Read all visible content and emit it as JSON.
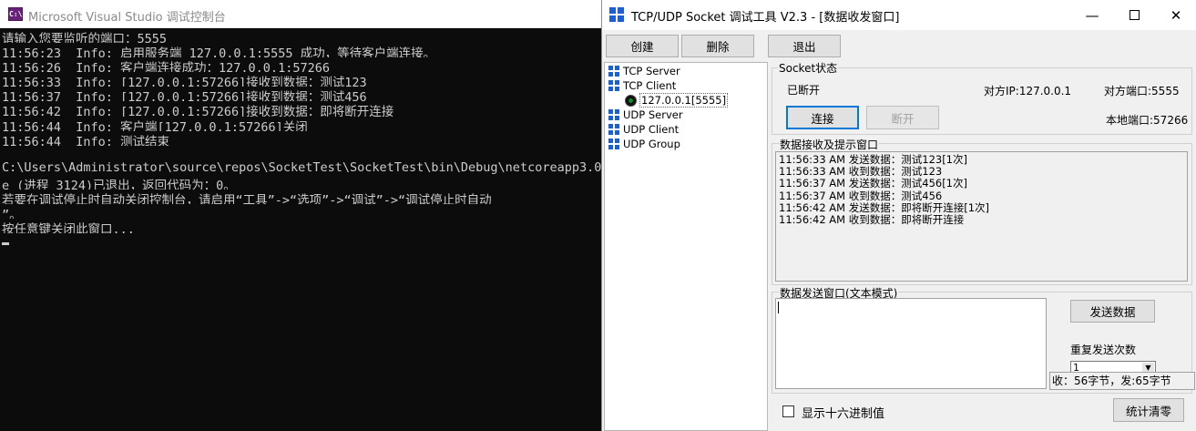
{
  "console": {
    "title": "Microsoft Visual Studio 调试控制台",
    "icon": "visual-studio-icon",
    "icon_text": "C:\\",
    "lines": [
      "请输入您要监听的端口：5555",
      "11:56:23  Info: 启用服务端 127.0.0.1:5555 成功，等待客户端连接。",
      "11:56:26  Info: 客户端连接成功：127.0.0.1:57266",
      "11:56:33  Info: [127.0.0.1:57266]接收到数据：测试123",
      "11:56:37  Info: [127.0.0.1:57266]接收到数据：测试456",
      "11:56:42  Info: [127.0.0.1:57266]接收到数据：即将断开连接",
      "11:56:44  Info: 客户端[127.0.0.1:57266]关闭",
      "11:56:44  Info: 测试结束",
      "",
      "C:\\Users\\Administrator\\source\\repos\\SocketTest\\SocketTest\\bin\\Debug\\netcoreapp3.0\\S",
      "e (进程 3124)已退出，返回代码为：0。",
      "若要在调试停止时自动关闭控制台，请启用“工具”->“选项”->“调试”->“调试停止时自动",
      "”。",
      "按任意键关闭此窗口..."
    ]
  },
  "tool": {
    "title": "TCP/UDP Socket 调试工具 V2.3 - [数据收发窗口]",
    "icon": "socket-tool-icon",
    "window_controls": {
      "minimize": "—",
      "maximize": "",
      "close": "✕"
    },
    "toolbar": {
      "create": "创建",
      "delete": "删除",
      "exit": "退出"
    },
    "tree": {
      "items": [
        "TCP Server",
        "TCP Client",
        "UDP Server",
        "UDP Client",
        "UDP Group"
      ],
      "connection": "127.0.0.1[5555]"
    },
    "socket_status": {
      "title": "Socket状态",
      "state": "已断开",
      "peer_ip": "对方IP:127.0.0.1",
      "peer_port": "对方端口:5555",
      "local_port": "本地端口:57266",
      "connect": "连接",
      "disconnect": "断开"
    },
    "receive": {
      "title": "数据接收及提示窗口",
      "lines": [
        "11:56:33 AM 发送数据：测试123[1次]",
        "11:56:33 AM 收到数据：测试123",
        "11:56:37 AM 发送数据：测试456[1次]",
        "11:56:37 AM 收到数据：测试456",
        "11:56:42 AM 发送数据：即将断开连接[1次]",
        "11:56:42 AM 收到数据：即将断开连接"
      ]
    },
    "send": {
      "title": "数据发送窗口(文本模式)",
      "button": "发送数据",
      "repeat_label": "重复发送次数",
      "repeat_value": "1",
      "stats": "收：56字节，发:65字节"
    },
    "bottom": {
      "hex_label": "显示十六进制值",
      "clear": "统计清零"
    },
    "accent_color": "#1c5ed6"
  }
}
